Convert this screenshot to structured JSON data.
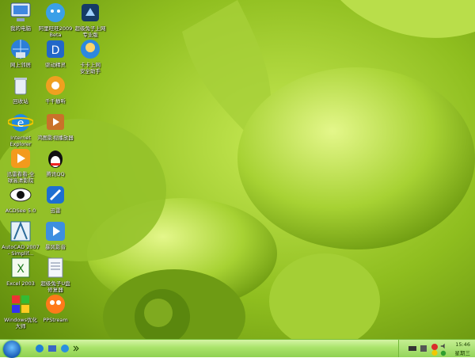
{
  "desktop": {
    "icons": [
      {
        "label": "我的电脑",
        "icon": "my-computer-icon"
      },
      {
        "label": "网上邻居",
        "icon": "network-icon"
      },
      {
        "label": "回收站",
        "icon": "recycle-bin-icon"
      },
      {
        "label": "Internet\nExplorer",
        "icon": "internet-explorer-icon"
      },
      {
        "label": "迅雷看看-全\n球高清影院",
        "icon": "xunlei-kankan-icon"
      },
      {
        "label": "ACDSee 5.0",
        "icon": "acdsee-icon"
      },
      {
        "label": "AutoCAD 2007\n- Simplif...",
        "icon": "autocad-icon"
      },
      {
        "label": "Excel 2003",
        "icon": "excel-icon"
      },
      {
        "label": "Windows优化\n大师",
        "icon": "windows-optimizer-icon"
      },
      {
        "label": "Word 2003",
        "icon": "word-icon"
      },
      {
        "label": "阿里旺旺2009\nBeta",
        "icon": "aliwangwang-icon"
      },
      {
        "label": "驱动精灵",
        "icon": "driver-genius-icon"
      },
      {
        "label": "千千静听",
        "icon": "ttplayer-icon"
      },
      {
        "label": "鸿图影视播放器",
        "icon": "media-player-icon"
      },
      {
        "label": "腾讯QQ",
        "icon": "qq-icon"
      },
      {
        "label": "迅雷",
        "icon": "xunlei-icon"
      },
      {
        "label": "暴风影音",
        "icon": "storm-player-icon"
      },
      {
        "label": "超级兔子U盘\n修复器",
        "icon": "document-icon"
      },
      {
        "label": "PPStream",
        "icon": "ppstream-icon"
      },
      {
        "label": "翻翻翻浏览器",
        "icon": "browser-icon"
      },
      {
        "label": "超级兔子上网\n专业版",
        "icon": "super-rabbit-icon"
      },
      {
        "label": "卡卡上网\n安全助手",
        "icon": "kaka-icon"
      }
    ]
  },
  "taskbar": {
    "clock_time": "15:46",
    "clock_day": "星期三"
  },
  "colors": {
    "wallpaper_green": "#9cc728",
    "taskbar_green": "#a9e36a"
  }
}
